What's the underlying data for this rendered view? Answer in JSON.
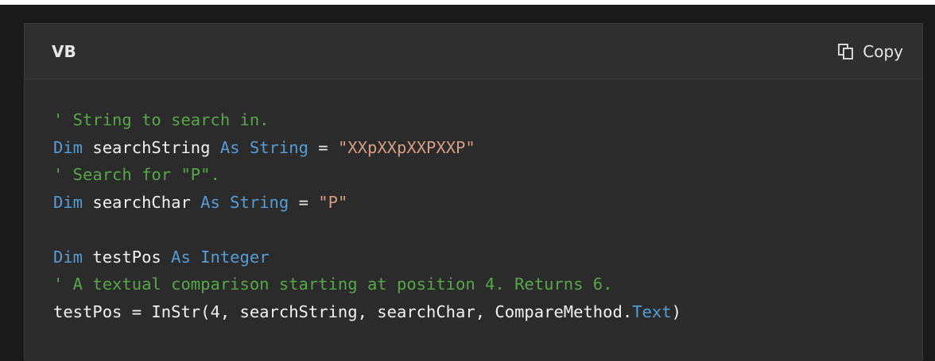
{
  "header": {
    "language_label": "VB",
    "copy_label": "Copy",
    "copy_icon": "copy-icon"
  },
  "colors": {
    "background": "#1a1a1a",
    "card": "#2b2b2b",
    "header": "#2f2f2f",
    "comment": "#57a64a",
    "keyword": "#569cd6",
    "string": "#d69d85",
    "text": "#e8e8e8"
  },
  "code": {
    "line1": {
      "comment": "' String to search in."
    },
    "line2": {
      "kw1": "Dim",
      "var": " searchString ",
      "kw2": "As",
      "sp": " ",
      "type": "String",
      "op": " = ",
      "str": "\"XXpXXpXXPXXP\""
    },
    "line3": {
      "comment": "' Search for \"P\"."
    },
    "line4": {
      "kw1": "Dim",
      "var": " searchChar ",
      "kw2": "As",
      "sp": " ",
      "type": "String",
      "op": " = ",
      "str": "\"P\""
    },
    "line5": {
      "blank": ""
    },
    "line6": {
      "kw1": "Dim",
      "var": " testPos ",
      "kw2": "As",
      "sp": " ",
      "type": "Integer"
    },
    "line7": {
      "comment": "' A textual comparison starting at position 4. Returns 6."
    },
    "line8": {
      "pre": "testPos = InStr(4, searchString, searchChar, CompareMethod.",
      "member": "Text",
      "post": ")"
    }
  }
}
